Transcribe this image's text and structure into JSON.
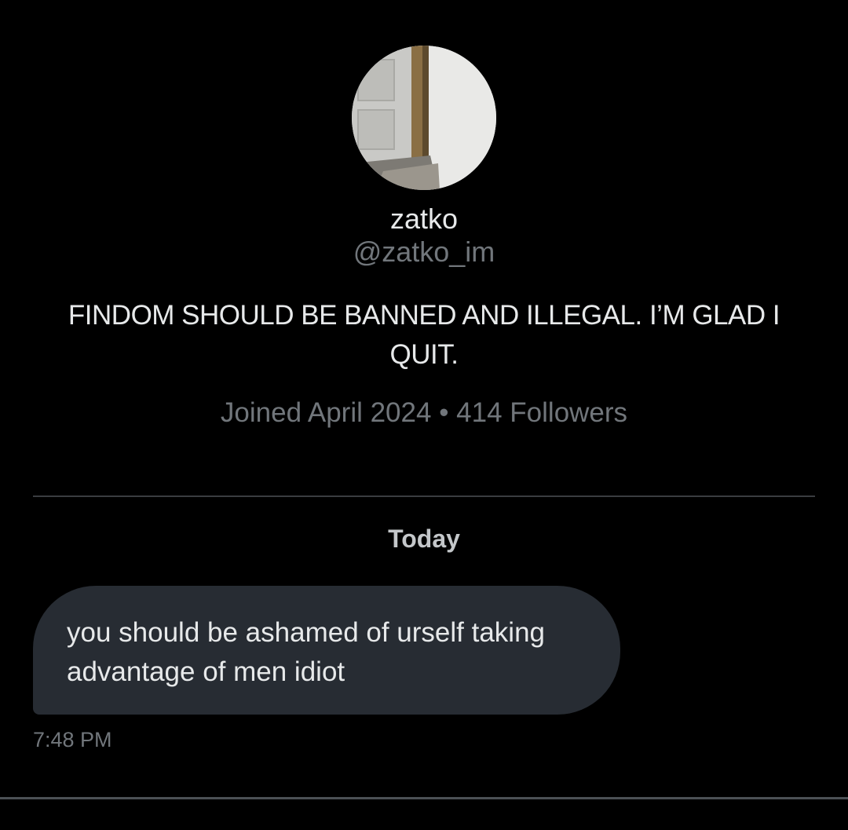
{
  "profile": {
    "display_name": "zatko",
    "handle": "@zatko_im",
    "bio": "FINDOM SHOULD BE BANNED AND ILLEGAL. I’M GLAD I QUIT.",
    "joined": "Joined April 2024",
    "separator": " • ",
    "followers": "414 Followers",
    "avatar_icon": "door-photo-avatar"
  },
  "conversation": {
    "date_separator": "Today",
    "messages": [
      {
        "text": "you should be ashamed of urself taking advantage of men idiot",
        "time": "7:48 PM"
      }
    ]
  },
  "colors": {
    "background": "#000000",
    "primary_text": "#e7e9ea",
    "secondary_text": "#71767b",
    "bubble": "#272c33",
    "divider": "#3a3d41"
  }
}
